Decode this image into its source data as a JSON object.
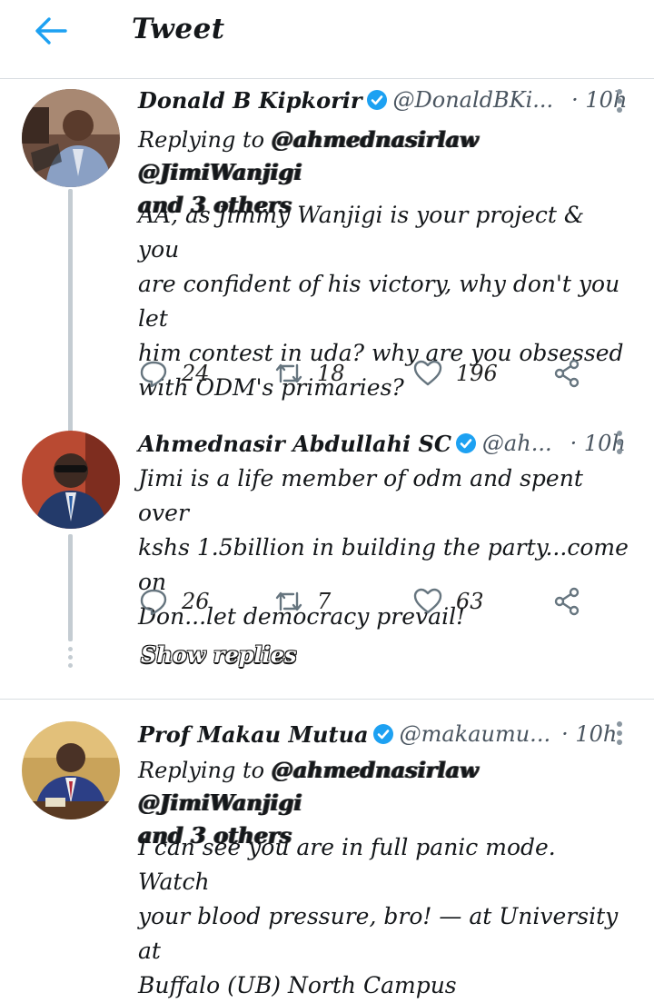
{
  "header": {
    "title": "Tweet"
  },
  "tweets": [
    {
      "name": "Donald B Kipkorir",
      "handle": "@DonaldBKi...",
      "time": "· 10h",
      "replying_prefix": "Replying to",
      "replying_mentions": [
        "@ahmednasirlaw",
        "@JimiWanjigi"
      ],
      "replying_others": "and 3 others",
      "body_lines": [
        "AA, as Jimmy Wanjigi is your project & you",
        "are confident of his victory, why don't you let",
        "him contest in uda? why are you obsessed",
        "with ODM's primaries?"
      ],
      "replies": "24",
      "retweets": "18",
      "likes": "196"
    },
    {
      "name": "Ahmednasir Abdullahi SC",
      "handle": "@ah...",
      "time": "· 10h",
      "body_lines": [
        "Jimi is a life member of odm and spent over",
        "kshs 1.5billion in building the party...come on",
        "Don...let democracy prevail!"
      ],
      "replies": "26",
      "retweets": "7",
      "likes": "63"
    },
    {
      "name": "Prof Makau Mutua",
      "handle": "@makaumu...",
      "time": "· 10h",
      "replying_prefix": "Replying to",
      "replying_mentions": [
        "@ahmednasirlaw",
        "@JimiWanjigi"
      ],
      "replying_others": "and 3 others",
      "body_lines": [
        "I can see you are in full panic mode.  Watch",
        "your blood pressure, bro! — at University at",
        "Buffalo (UB) North Campus"
      ]
    }
  ],
  "show_replies_label": "Show replies",
  "colors": {
    "accent": "#1da1f2",
    "icon": "#66757f",
    "divider": "#d8dde1"
  }
}
